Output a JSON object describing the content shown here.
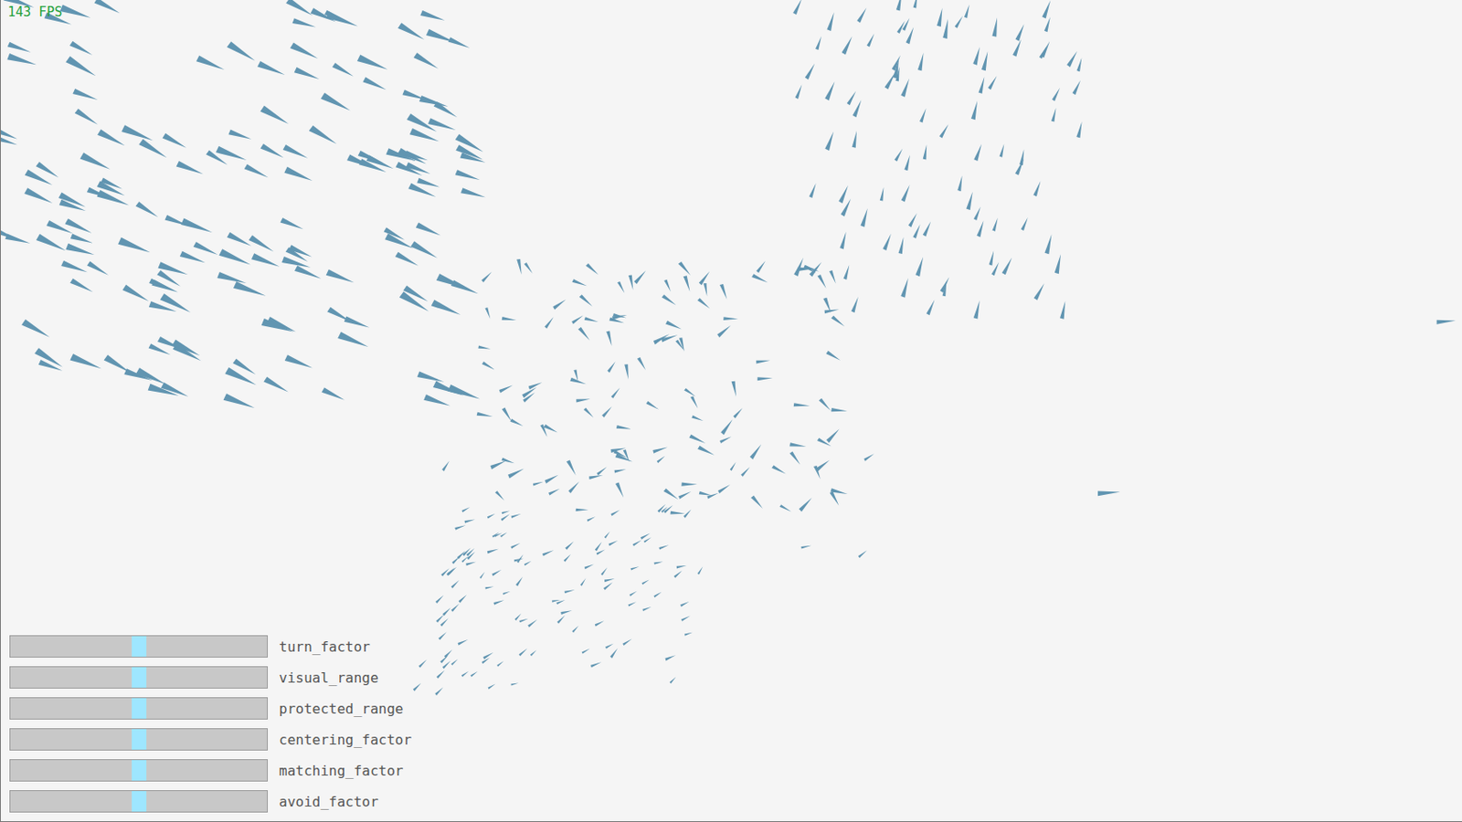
{
  "fps": "143 FPS",
  "sliders": [
    {
      "label": "turn_factor",
      "level": 0.5
    },
    {
      "label": "visual_range",
      "level": 0.5
    },
    {
      "label": "protected_range",
      "level": 0.5
    },
    {
      "label": "centering_factor",
      "level": 0.5
    },
    {
      "label": "matching_factor",
      "level": 0.5
    },
    {
      "label": "avoid_factor",
      "level": 0.5
    }
  ]
}
